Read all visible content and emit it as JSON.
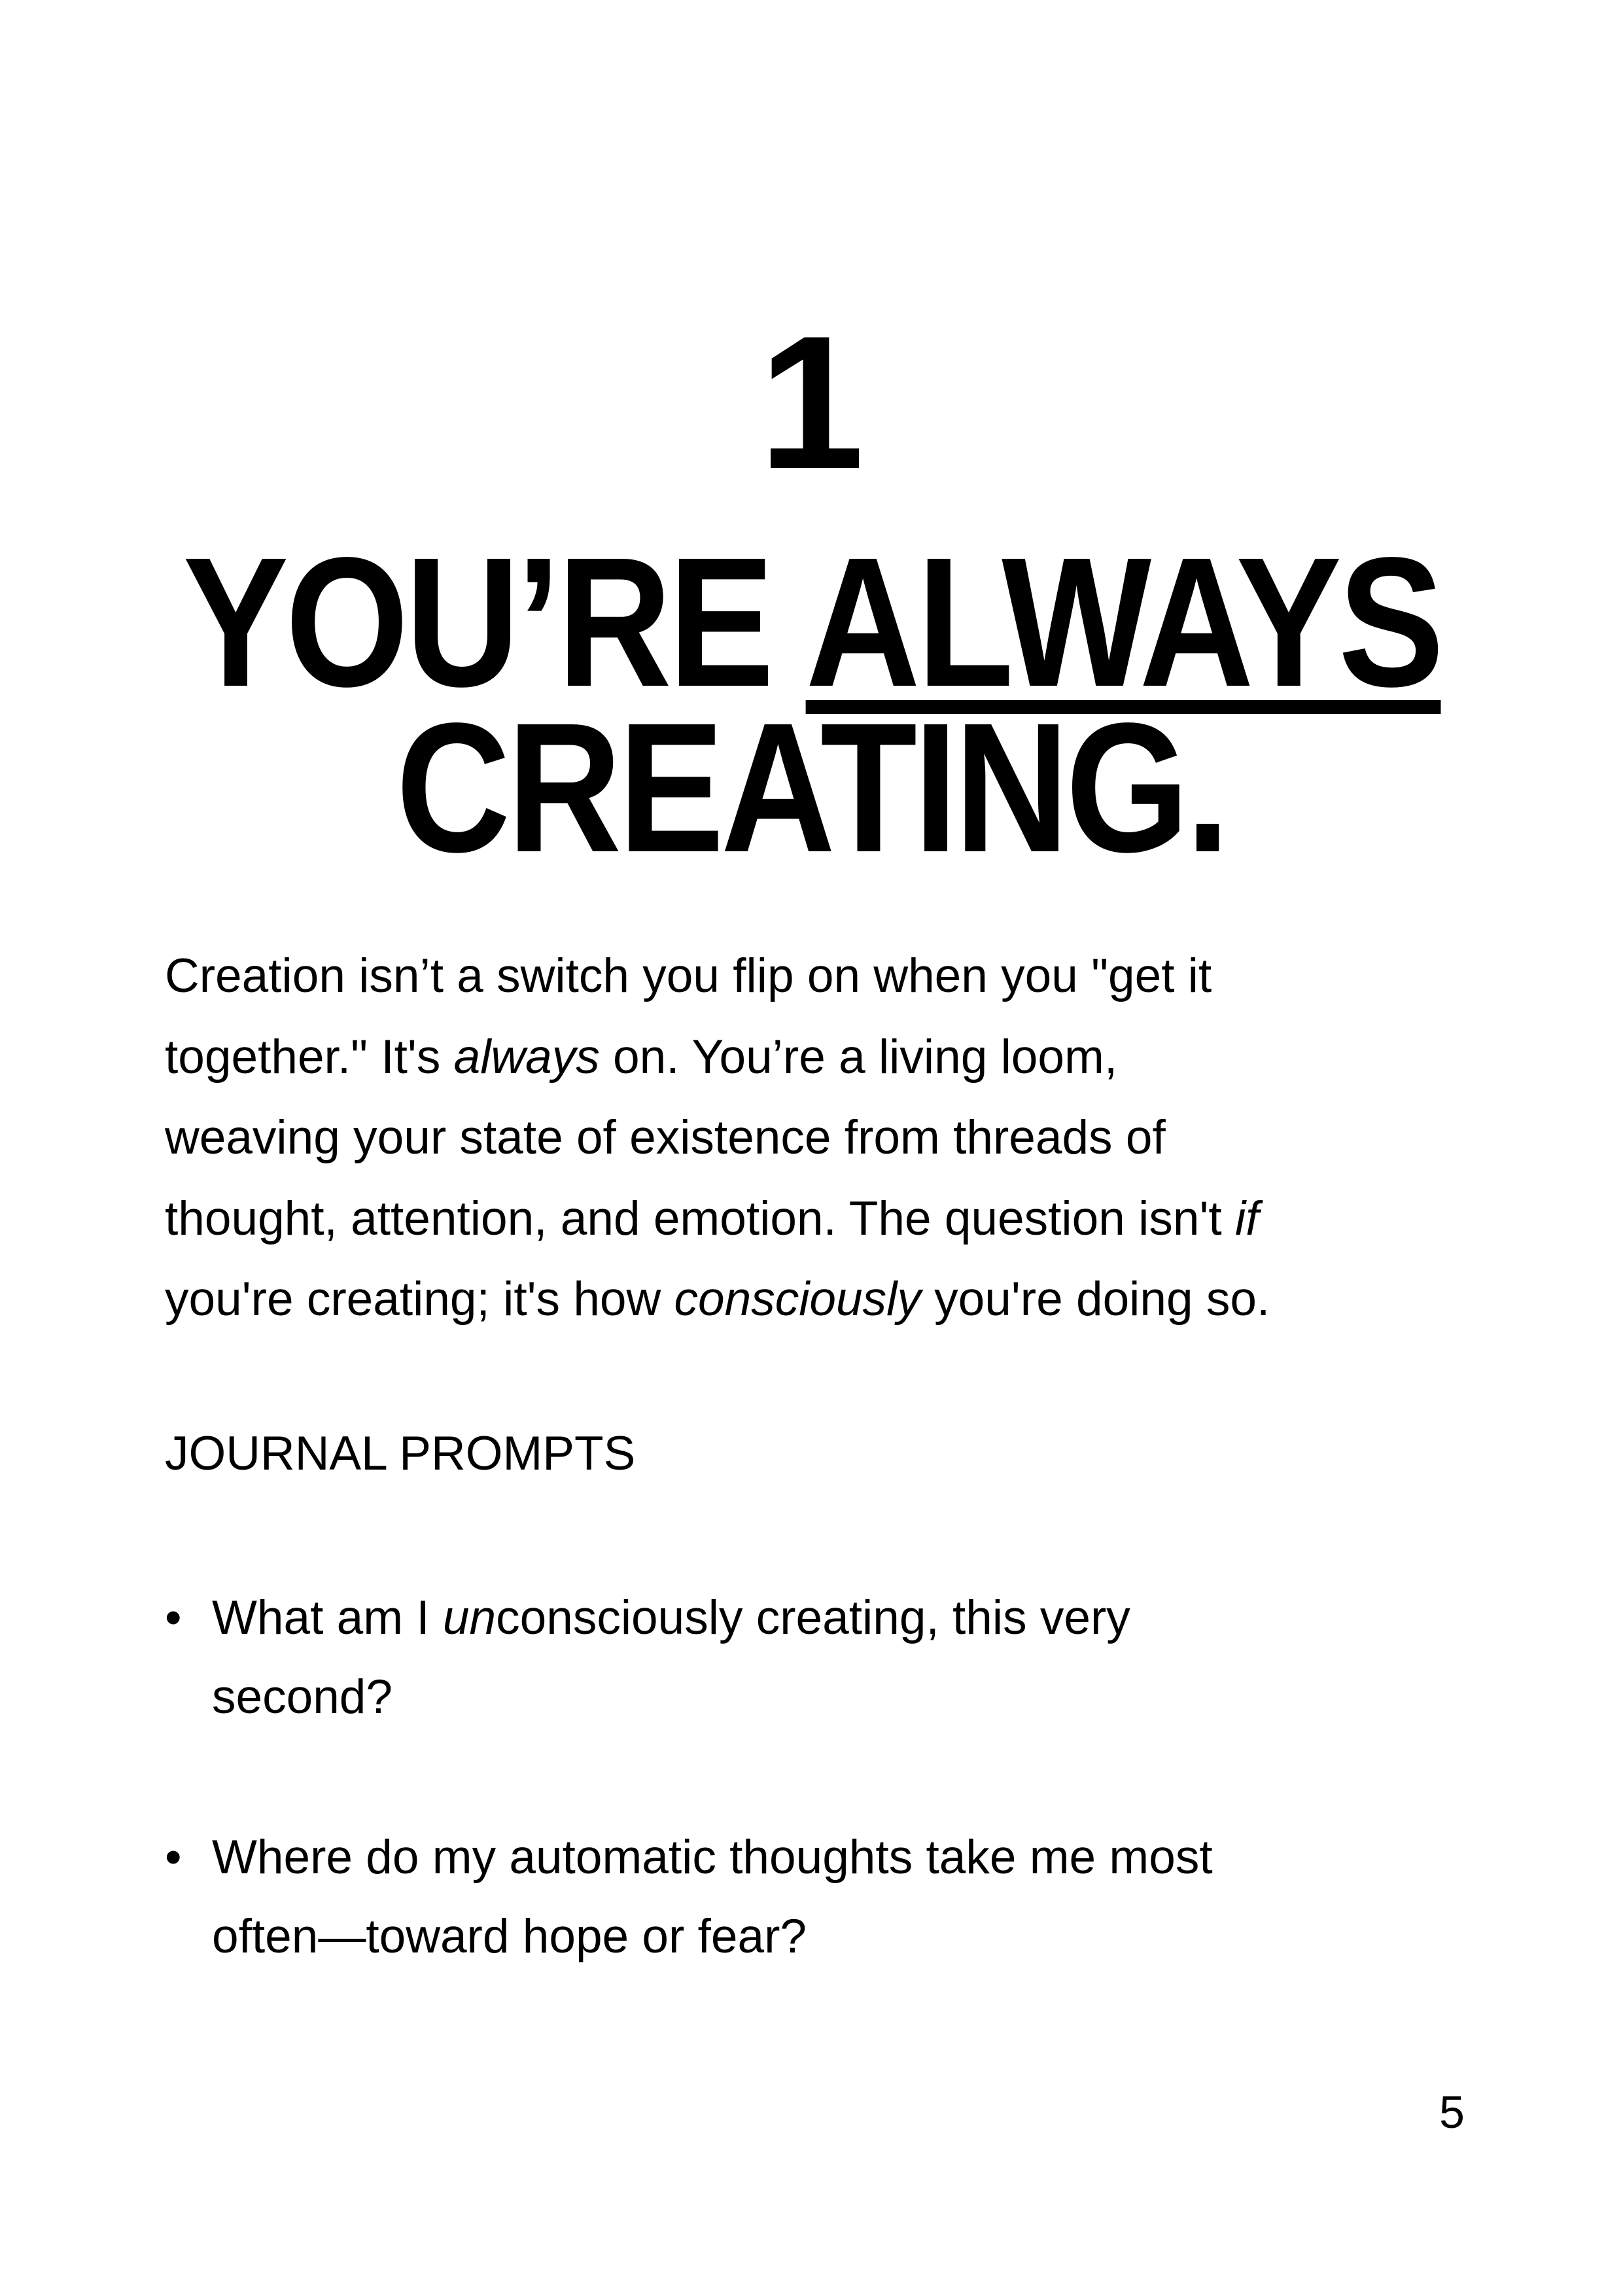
{
  "chapter_number": "1",
  "title": {
    "line1_pre": "YOU’RE ",
    "line1_underlined": "ALWAYS",
    "line2": "CREATING."
  },
  "body": {
    "l1": "Creation isn’t a switch you flip on when you \"get it",
    "l2a": "together.\" It's ",
    "l2i": "always",
    "l2b": " on. You’re a living loom,",
    "l3": "weaving your state of existence from threads of",
    "l4a": "thought, attention, and emotion. The question isn't ",
    "l4i": "if",
    "l5a": "you're creating; it's how ",
    "l5i": "consciously",
    "l5b": " you're doing so."
  },
  "journal_heading": "JOURNAL PROMPTS",
  "prompts": [
    {
      "bullet": "•",
      "l1a": "What am I ",
      "l1i": "un",
      "l1b": "consciously creating, this very",
      "l2": "second?"
    },
    {
      "bullet": "•",
      "l1": "Where do my automatic thoughts take me most",
      "l2": "often—toward hope or fear?"
    }
  ],
  "page_number": "5"
}
